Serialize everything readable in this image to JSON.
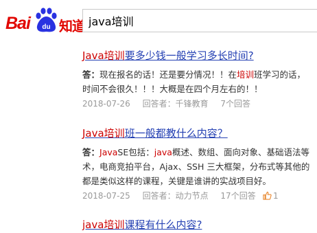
{
  "header": {
    "logo_bai": "Bai",
    "logo_du": "du",
    "logo_zhidao": "知道",
    "search_value": "java培训"
  },
  "results": [
    {
      "title_hl": "Java培训",
      "title_rest": "要多少钱一般学习多长时间?",
      "answer_label": "答：",
      "answer_line1_pre": "现在报名的话！还是要分情况！！在",
      "answer_line1_hl": "培训",
      "answer_line1_post": "班学习的话，",
      "answer_line2": "时间不会很久！！！大概是在四个月左右的！！",
      "date": "2018-07-26",
      "answerer": "回答者：千锋教育",
      "answers": "7个回答"
    },
    {
      "title_hl": "Java培训",
      "title_rest": "班一般都教什么内容？",
      "answer_label": "答：",
      "answer_line1_hl1": "Java",
      "answer_line1_mid": "SE包括：",
      "answer_line1_hl2": "java",
      "answer_line1_post": "概述、数组、面向对象、基础语法等",
      "answer_line2": "术，电商竞拍平台，Ajax、SSH 三大框架，分布式等其他的",
      "answer_line3": "都是类似这样的课程，关键是谁讲的实战项目好。",
      "date": "2018-07-25",
      "answerer": "回答者：动力节点",
      "answers": "17个回答",
      "likes": "1"
    },
    {
      "title_hl": "java培训",
      "title_rest": "课程有什么内容?"
    }
  ],
  "colors": {
    "brand_red": "#e10601",
    "brand_blue": "#2932e1",
    "link": "#2440b3",
    "highlight": "#cc0000",
    "meta": "#999999"
  }
}
